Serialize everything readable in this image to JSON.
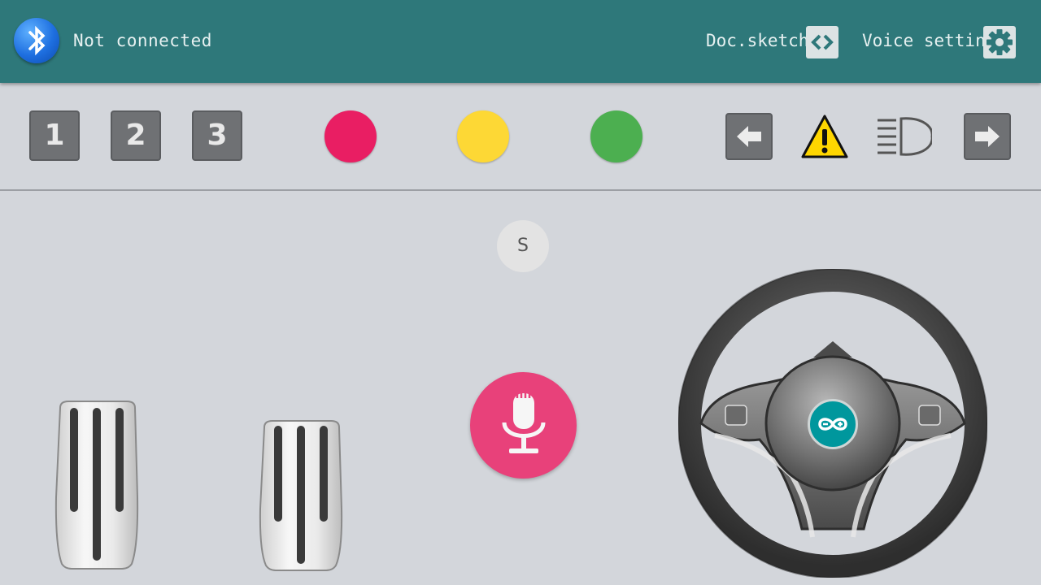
{
  "header": {
    "connection_status": "Not connected",
    "doc_label": "Doc.sketch",
    "voice_label": "Voice setting"
  },
  "toolbar": {
    "presets": [
      "1",
      "2",
      "3"
    ],
    "color_buttons": [
      {
        "name": "red",
        "color": "#e91e63"
      },
      {
        "name": "yellow",
        "color": "#fdd835"
      },
      {
        "name": "green",
        "color": "#4caf50"
      }
    ]
  },
  "controls": {
    "s_label": "S"
  },
  "colors": {
    "header_bg": "#2e787a",
    "page_bg": "#d3d6db",
    "mic_bg": "#e8417a",
    "logo_teal": "#00979d"
  }
}
